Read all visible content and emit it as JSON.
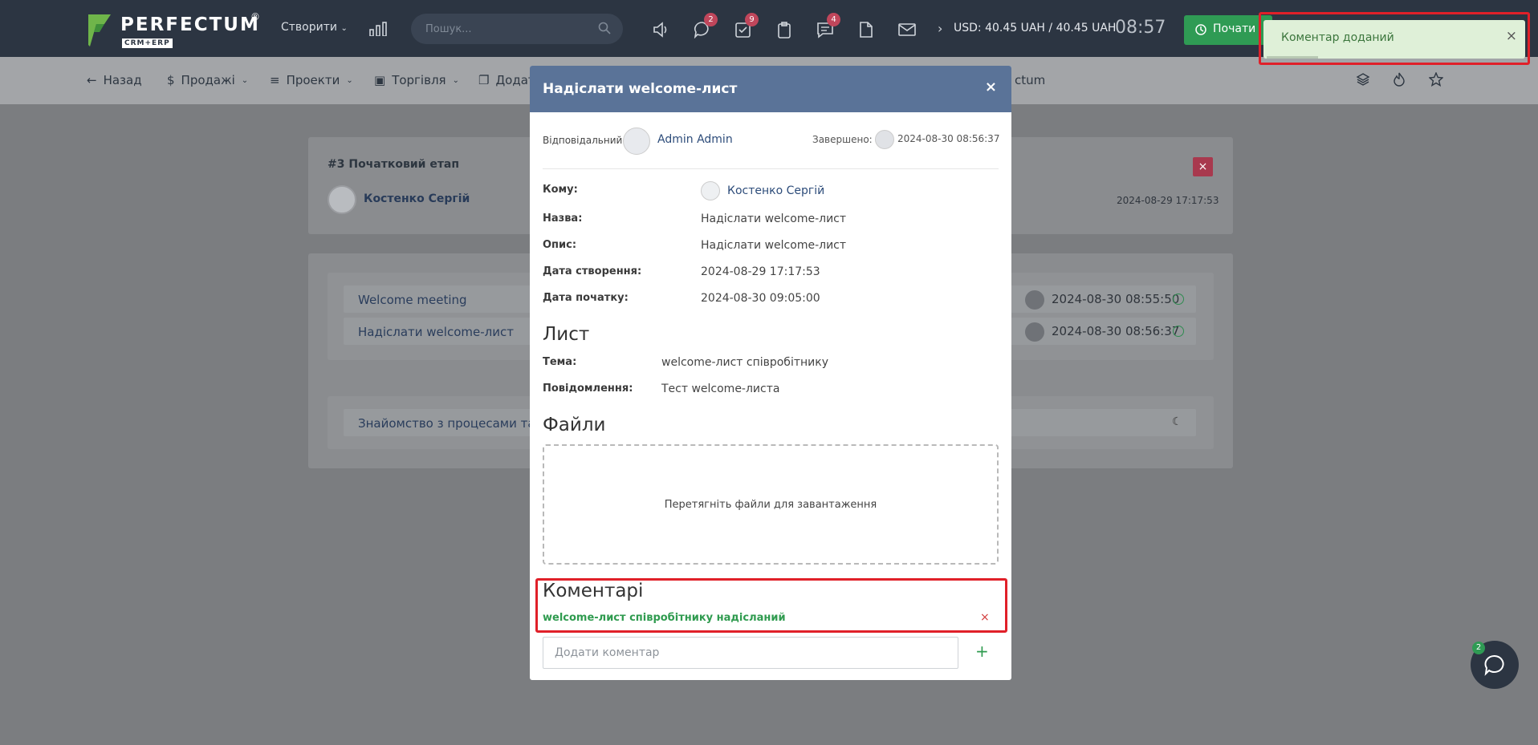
{
  "topbar": {
    "logo_word": "PERFECTUM",
    "logo_reg": "®",
    "logo_sub": "CRM+ERP",
    "create_label": "Створити",
    "search_placeholder": "Пошук...",
    "badges": {
      "chat": "2",
      "tasks": "9",
      "messages": "4"
    },
    "currency": "USD: 40.45 UAH / 40.45 UAH",
    "time": "08:57",
    "start_label": "Почати"
  },
  "subnav": {
    "items": [
      "Назад",
      "Продажі",
      "Проекти",
      "Торгівля",
      "Додат",
      "ctum"
    ]
  },
  "page": {
    "stage_title": "#3 Початковий етап",
    "stage_close": "×",
    "person": "Костенко Сергій",
    "stage_date": "2024-08-29 17:17:53",
    "tasks": [
      {
        "label": "Welcome meeting",
        "date": "2024-08-30 08:55:50"
      },
      {
        "label": "Надіслати welcome-лист",
        "date": "2024-08-30 08:56:37"
      }
    ],
    "pending_task": "Знайомство з процесами та доку"
  },
  "modal": {
    "title": "Надіслати welcome-лист",
    "close": "×",
    "responsible_label": "Відповідальний",
    "responsible_user": "Admin Admin",
    "done_label": "Завершено:",
    "done_date": "2024-08-30 08:56:37",
    "fields": [
      {
        "label": "Кому:",
        "value": "Костенко Сергій"
      },
      {
        "label": "Назва:",
        "value": "Надіслати welcome-лист"
      },
      {
        "label": "Опис:",
        "value": "Надіслати welcome-лист"
      },
      {
        "label": "Дата створення:",
        "value": "2024-08-29 17:17:53"
      },
      {
        "label": "Дата початку:",
        "value": "2024-08-30 09:05:00"
      }
    ],
    "letter_section": "Лист",
    "letter_fields": [
      {
        "label": "Тема:",
        "value": "welcome-лист співробітнику"
      },
      {
        "label": "Повідомлення:",
        "value": "Тест welcome-листа"
      }
    ],
    "files_section": "Файли",
    "dropzone_text": "Перетягніть файли для завантаження",
    "comments_section": "Коментарі",
    "comment": "welcome-лист співробітнику надісланий",
    "comment_delete": "×",
    "comment_placeholder": "Додати коментар",
    "comment_add": "+"
  },
  "toast": {
    "text": "Коментар доданий",
    "close": "×",
    "progress": 0.2
  },
  "chat": {
    "badge": "2"
  },
  "colors": {
    "topbar": "#2c3542",
    "modal_header": "#5a7398",
    "success": "#2f9b54",
    "highlight": "#e02029",
    "toast_bg": "#dff0d8"
  }
}
